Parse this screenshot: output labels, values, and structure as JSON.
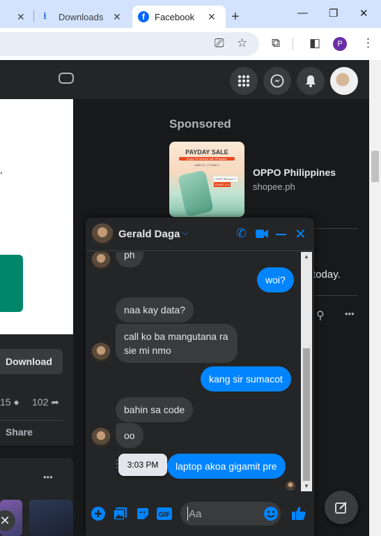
{
  "browser": {
    "tabs": [
      {
        "label": "",
        "active": false
      },
      {
        "label": "Downloads",
        "active": false
      },
      {
        "label": "Facebook",
        "active": true
      }
    ],
    "new_tab_label": "+",
    "window_controls": [
      "—",
      "❐",
      "✕"
    ],
    "profile_initial": "P",
    "accent_color": "#d3e3fd"
  },
  "feed": {
    "download_label": "Download",
    "comments_count": "15",
    "shares_count": "102",
    "share_label": "Share",
    "more_label": "•••"
  },
  "right_rail": {
    "sponsored_label": "Sponsored",
    "ad": {
      "title": "OPPO Philippines",
      "domain": "shopee.ph",
      "image_text": {
        "headline": "PAYDAY SALE",
        "banner": "Enjoy 0% Interest with SPaylater",
        "dates": "MAR 15 - 17 ONLY!",
        "product": "OPPO Reno11 F",
        "price": "₱4,557 X 6"
      }
    },
    "truncated_text": "today.",
    "more_label": "•••"
  },
  "chat": {
    "contact_name": "Gerald Daga",
    "messages": [
      {
        "dir": "in",
        "text": "ph"
      },
      {
        "dir": "out",
        "text": "woi?"
      },
      {
        "dir": "in",
        "text": "naa kay data?"
      },
      {
        "dir": "in",
        "text": "call ko ba mangutana ra sie mi nmo"
      },
      {
        "dir": "out",
        "text": "kang sir sumacot"
      },
      {
        "dir": "in",
        "text": "bahin sa code"
      },
      {
        "dir": "in",
        "text": "oo"
      },
      {
        "dir": "out",
        "text": "laptop akoa gigamit pre"
      }
    ],
    "tooltip_time": "3:03 PM",
    "composer_placeholder": "Aa",
    "accent": "#0084ff"
  }
}
